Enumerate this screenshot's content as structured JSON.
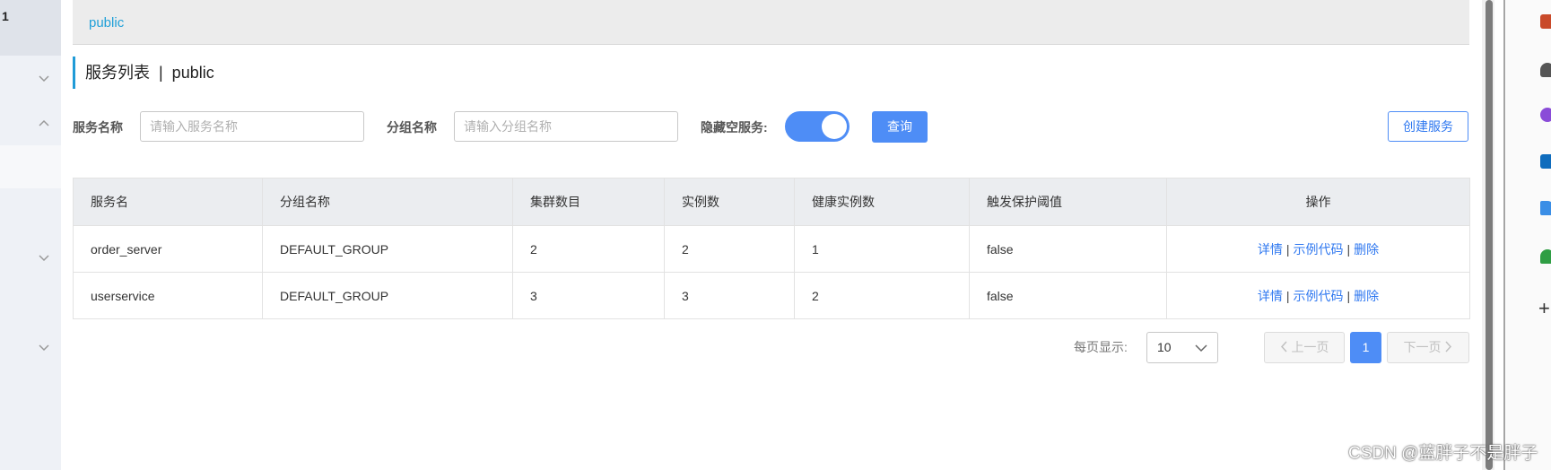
{
  "sidebar": {
    "top_label": "1"
  },
  "namespace_bar": {
    "active": "public"
  },
  "page_title": "服务列表  |  public",
  "filters": {
    "service_name_label": "服务名称",
    "service_name_placeholder": "请输入服务名称",
    "group_name_label": "分组名称",
    "group_name_placeholder": "请输入分组名称",
    "hide_empty_label": "隐藏空服务:",
    "hide_empty_on": true,
    "query_button": "查询",
    "create_button": "创建服务"
  },
  "table": {
    "headers": [
      "服务名",
      "分组名称",
      "集群数目",
      "实例数",
      "健康实例数",
      "触发保护阈值",
      "操作"
    ],
    "rows": [
      {
        "service": "order_server",
        "group": "DEFAULT_GROUP",
        "clusters": "2",
        "instances": "2",
        "healthy": "1",
        "threshold": "false"
      },
      {
        "service": "userservice",
        "group": "DEFAULT_GROUP",
        "clusters": "3",
        "instances": "3",
        "healthy": "2",
        "threshold": "false"
      }
    ],
    "actions": {
      "detail": "详情",
      "sample_code": "示例代码",
      "delete": "删除",
      "separator": "|"
    }
  },
  "pagination": {
    "per_page_label": "每页显示:",
    "per_page_value": "10",
    "prev": "上一页",
    "next": "下一页",
    "current_page": "1"
  },
  "watermark": "CSDN @蓝胖子不是胖子",
  "colors": {
    "accent": "#4e8df6",
    "link": "#2f78f0",
    "namespace": "#20a0d8"
  }
}
